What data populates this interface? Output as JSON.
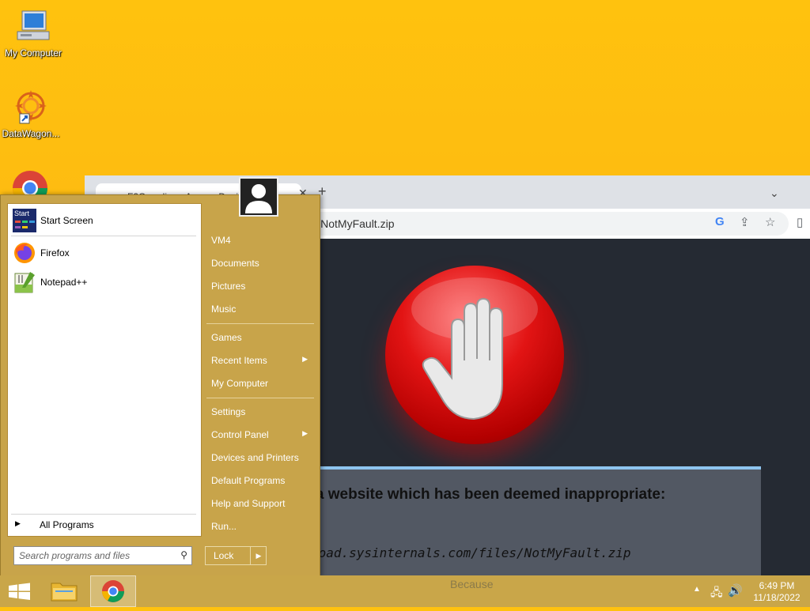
{
  "desktop": {
    "icons": [
      {
        "label": "My Computer"
      },
      {
        "label": "DataWagon..."
      }
    ]
  },
  "browser": {
    "tab_title": "F2Guardian - Access Denied",
    "address": "https://download.sysinternals.com/files/NotMyFault.zip",
    "address_visible": "om/files/NotMyFault.zip",
    "message": "ried visiting a website which has been deemed inappropriate:",
    "blocked_url": "ttps://download.sysinternals.com/files/NotMyFault.zip",
    "footer": "Because"
  },
  "start_menu": {
    "left_items": [
      {
        "label": "Start Screen",
        "icon": "start-screen-icon"
      },
      {
        "label": "Firefox",
        "icon": "firefox-icon"
      },
      {
        "label": "Notepad++",
        "icon": "notepadpp-icon"
      }
    ],
    "all_programs": "All Programs",
    "search_placeholder": "Search programs and files",
    "right_items": [
      {
        "label": "VM4"
      },
      {
        "label": "Documents"
      },
      {
        "label": "Pictures"
      },
      {
        "label": "Music"
      },
      {
        "label": "Games"
      },
      {
        "label": "Recent Items"
      },
      {
        "label": "My Computer"
      },
      {
        "label": "Settings"
      },
      {
        "label": "Control Panel"
      },
      {
        "label": "Devices and Printers"
      },
      {
        "label": "Default Programs"
      },
      {
        "label": "Help and Support"
      },
      {
        "label": "Run..."
      }
    ],
    "lock_label": "Lock",
    "start_tile_text": "Start"
  },
  "taskbar": {
    "time": "6:49 PM",
    "date": "11/18/2022"
  },
  "colors": {
    "desktop": "#fdb813",
    "startmenu": "#c8a44a",
    "stop_red": "#e21414"
  }
}
